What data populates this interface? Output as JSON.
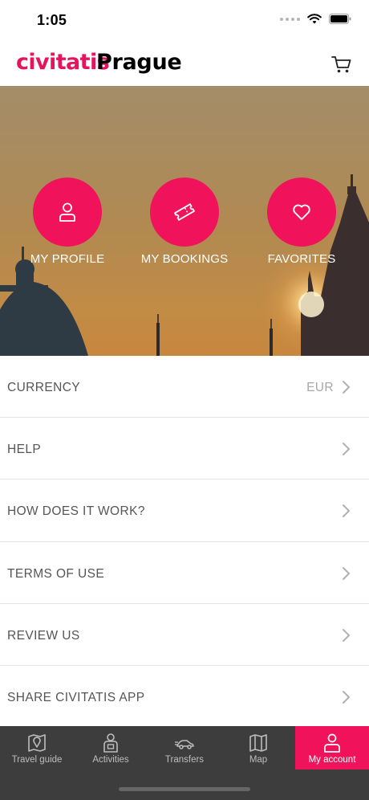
{
  "status_bar": {
    "time": "1:05"
  },
  "header": {
    "brand": "civitatis",
    "city": "Prague",
    "cart_icon": "cart-icon"
  },
  "hero": {
    "buttons": [
      {
        "label": "MY PROFILE",
        "icon": "user-icon"
      },
      {
        "label": "MY BOOKINGS",
        "icon": "ticket-icon"
      },
      {
        "label": "FAVORITES",
        "icon": "heart-icon"
      }
    ]
  },
  "menu": {
    "items": [
      {
        "label": "CURRENCY",
        "value": "EUR"
      },
      {
        "label": "HELP"
      },
      {
        "label": "HOW DOES IT WORK?"
      },
      {
        "label": "TERMS OF USE"
      },
      {
        "label": "REVIEW US"
      },
      {
        "label": "SHARE CIVITATIS APP"
      }
    ]
  },
  "tabbar": {
    "tabs": [
      {
        "label": "Travel guide",
        "icon": "map-pin-icon"
      },
      {
        "label": "Activities",
        "icon": "activities-icon"
      },
      {
        "label": "Transfers",
        "icon": "car-icon"
      },
      {
        "label": "Map",
        "icon": "map-icon"
      },
      {
        "label": "My account",
        "icon": "account-icon",
        "active": true
      }
    ]
  },
  "colors": {
    "accent": "#f0125b",
    "brand": "#e8135d",
    "tabbar": "#3d3d3d"
  }
}
